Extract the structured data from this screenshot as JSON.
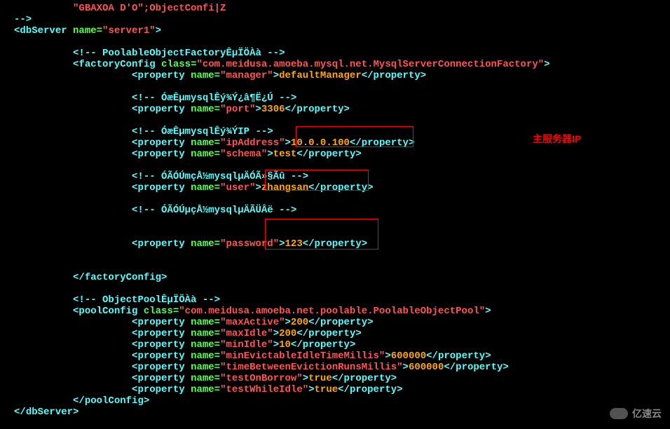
{
  "partial_top_line": "\"GBAXOA D'O\";ObjectConfi|Z",
  "close_comment": "-->",
  "dbserver_open_tag": "dbServer",
  "dbserver_attr_name": "name",
  "dbserver_name": "server1",
  "comment_poolable": "PoolableObjectFactoryÊµÏÖÀà",
  "factoryconfig_tag": "factoryConfig",
  "factoryconfig_attr": "class",
  "factoryconfig_class": "com.meidusa.amoeba.mysql.net.MysqlServerConnectionFactory",
  "prop_tag": "property",
  "prop_name_attr": "name",
  "prop_manager_name": "manager",
  "prop_manager_value": "defaultManager",
  "comment_port": "ÓæÊµmysqlÊý¾Ý¿â¶Ë¿Ú",
  "prop_port_name": "port",
  "prop_port_value": "3306",
  "comment_ip": "ÓæÊµmysqlÊý¾ÝIP",
  "prop_ipaddress_name": "ipAddress",
  "prop_ipaddress_value": "10.0.0.100",
  "prop_schema_name": "schema",
  "prop_schema_value": "test",
  "comment_user": "ÓÃÓÚmçÅ½mysqlµÄÓÃ»§Ãû",
  "prop_user_name": "user",
  "prop_user_value": "zhangsan",
  "comment_password": "ÓÃÓÚµçÅ½mysqlµÄÃÜÂë",
  "prop_password_name": "password",
  "prop_password_value": "123",
  "factoryconfig_close": "factoryConfig",
  "comment_objectpool": "ObjectPoolÊµÏÖÀà",
  "poolconfig_tag": "poolConfig",
  "poolconfig_attr": "class",
  "poolconfig_class": "com.meidusa.amoeba.net.poolable.PoolableObjectPool",
  "prop_maxactive_name": "maxActive",
  "prop_maxactive_value": "200",
  "prop_maxidle_name": "maxIdle",
  "prop_maxidle_value": "200",
  "prop_minidle_name": "minIdle",
  "prop_minidle_value": "10",
  "prop_minevictable_name": "minEvictableIdleTimeMillis",
  "prop_minevictable_value": "600000",
  "prop_timebetween_name": "timeBetweenEvictionRunsMillis",
  "prop_timebetween_value": "600000",
  "prop_testonborrow_name": "testOnBorrow",
  "prop_testonborrow_value": "true",
  "prop_testwhileidle_name": "testWhileIdle",
  "prop_testwhileidle_value": "true",
  "poolconfig_close": "poolConfig",
  "dbserver_close": "dbServer",
  "annotation_cn": "主服务器IP",
  "watermark_text": "亿速云"
}
